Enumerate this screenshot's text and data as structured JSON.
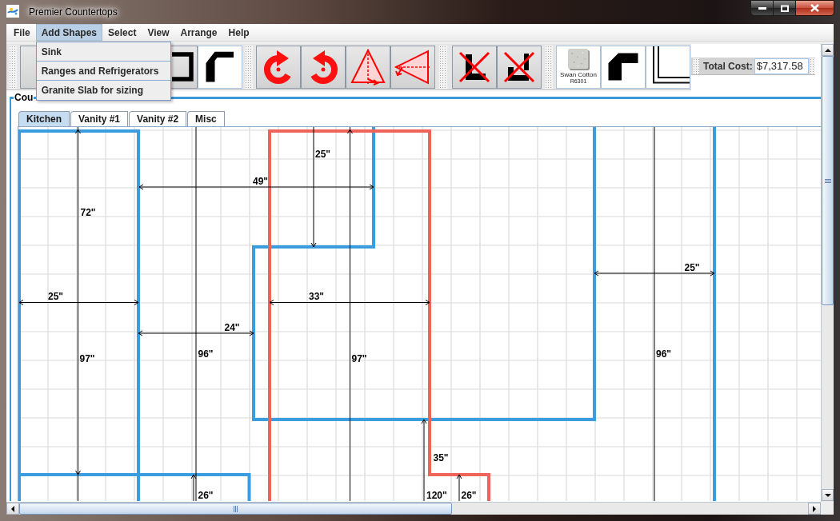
{
  "window": {
    "title": "Premier Countertops"
  },
  "menu": [
    {
      "label": "File",
      "selected": false
    },
    {
      "label": "Add Shapes",
      "selected": true
    },
    {
      "label": "Select",
      "selected": false
    },
    {
      "label": "View",
      "selected": false
    },
    {
      "label": "Arrange",
      "selected": false
    },
    {
      "label": "Help",
      "selected": false
    }
  ],
  "dropdown": {
    "items": [
      {
        "label": "Sink"
      },
      {
        "label": "Ranges and Refrigerators"
      },
      {
        "label": "Granite Slab for sizing"
      }
    ]
  },
  "toolbar": {
    "groups": [
      {
        "buttons": [
          {
            "kind": "plain"
          },
          {
            "kind": "u-shape"
          },
          {
            "kind": "corner"
          }
        ]
      },
      {
        "buttons": [
          {
            "kind": "rotate-cw"
          },
          {
            "kind": "rotate-ccw"
          },
          {
            "kind": "flip-horizontal"
          },
          {
            "kind": "flip-vertical"
          }
        ]
      },
      {
        "buttons": [
          {
            "kind": "delete-l"
          },
          {
            "kind": "delete-corner"
          }
        ]
      },
      {
        "buttons": [
          {
            "kind": "granite",
            "label": "Swan Cotton",
            "code": "R6301"
          },
          {
            "kind": "bevel-corner"
          },
          {
            "kind": "edge-profile"
          }
        ]
      }
    ]
  },
  "total_cost": {
    "label": "Total Cost:",
    "value": "$7,317.58"
  },
  "panel": {
    "title": "Cou"
  },
  "tabs": [
    {
      "label": "Kitchen",
      "selected": true
    },
    {
      "label": "Vanity #1",
      "selected": false
    },
    {
      "label": "Vanity #2",
      "selected": false
    },
    {
      "label": "Misc",
      "selected": false
    }
  ],
  "canvas": {
    "shapes": [
      {
        "selected": false
      },
      {
        "selected": false
      },
      {
        "selected": true
      },
      {
        "selected": false
      },
      {
        "selected": false
      }
    ],
    "dimension_labels": [
      "25\"",
      "49\"",
      "72\"",
      "25\"",
      "25\"",
      "33\"",
      "24\"",
      "96\"",
      "97\"",
      "97\"",
      "96\"",
      "35\"",
      "26\"",
      "120\"",
      "26\""
    ]
  }
}
